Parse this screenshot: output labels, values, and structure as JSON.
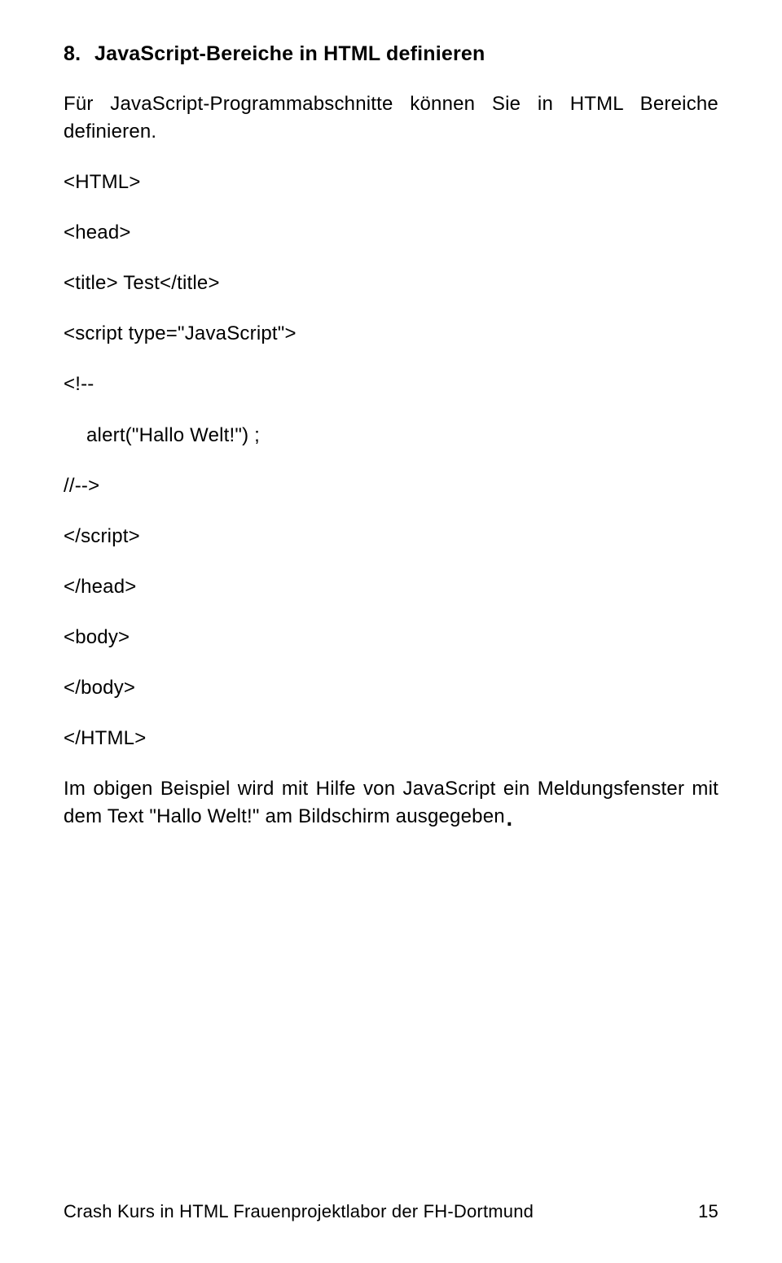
{
  "heading": {
    "number": "8.",
    "title": "JavaScript-Bereiche in HTML definieren"
  },
  "intro": "Für JavaScript-Programmabschnitte können Sie in HTML Bereiche definieren.",
  "code": {
    "l1": "<HTML>",
    "l2": "<head>",
    "l3": "<title> Test</title>",
    "l4": "<script type=\"JavaScript\">",
    "l5": "<!--",
    "l6": "alert(\"Hallo Welt!\") ;",
    "l7": "//-->",
    "l8": "</script>",
    "l9": "</head>",
    "l10": "<body>",
    "l11": "</body>",
    "l12": "</HTML>"
  },
  "outro": "Im obigen Beispiel wird mit Hilfe von JavaScript ein Meldungsfenster mit dem Text \"Hallo Welt!\" am Bildschirm ausgegeben",
  "footer": {
    "text": "Crash Kurs in HTML Frauenprojektlabor der FH-Dortmund",
    "page": "15"
  }
}
